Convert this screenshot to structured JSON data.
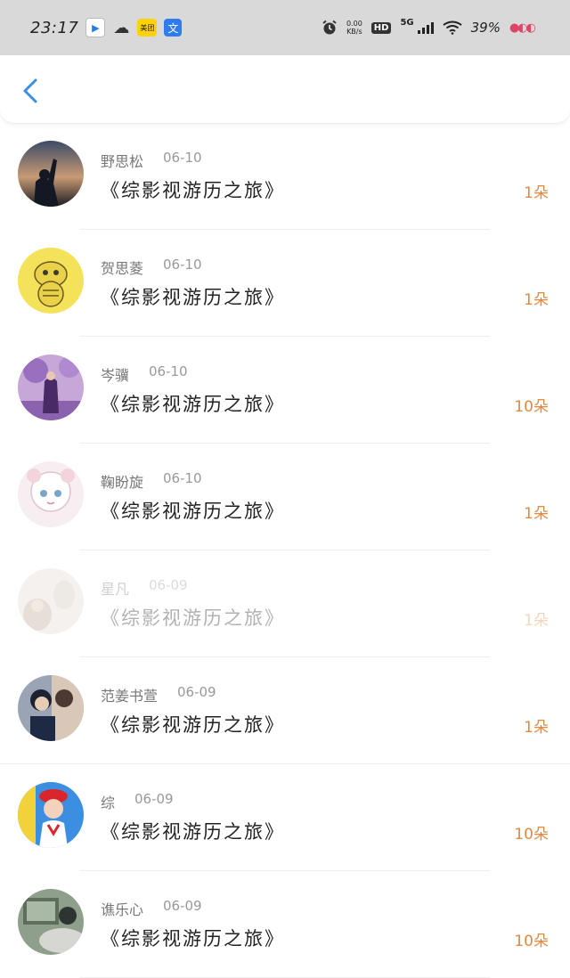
{
  "status": {
    "time": "23:17",
    "app_icons": [
      "tencent-video-icon",
      "wechat-icon",
      "meituan-icon",
      "translate-icon"
    ],
    "meituan_label": "美团",
    "translate_label": "文",
    "net_speed_value": "0.00",
    "net_speed_unit": "KB/s",
    "hd_label": "HD",
    "network": "5G",
    "battery": "39%"
  },
  "list": [
    {
      "name": "野思松",
      "date": "06-10",
      "title": "《综影视游历之旅》",
      "count": "1朵"
    },
    {
      "name": "贺思菱",
      "date": "06-10",
      "title": "《综影视游历之旅》",
      "count": "1朵"
    },
    {
      "name": "岑骥",
      "date": "06-10",
      "title": "《综影视游历之旅》",
      "count": "10朵"
    },
    {
      "name": "鞠盼旋",
      "date": "06-10",
      "title": "《综影视游历之旅》",
      "count": "1朵"
    },
    {
      "name": "星凡",
      "date": "06-09",
      "title": "《综影视游历之旅》",
      "count": "1朵"
    },
    {
      "name": "范姜书萱",
      "date": "06-09",
      "title": "《综影视游历之旅》",
      "count": "1朵"
    },
    {
      "name": "综",
      "date": "06-09",
      "title": "《综影视游历之旅》",
      "count": "10朵"
    },
    {
      "name": "谯乐心",
      "date": "06-09",
      "title": "《综影视游历之旅》",
      "count": "10朵"
    }
  ],
  "colors": {
    "accent_back": "#3a8ee6",
    "count_color": "#e08a44"
  }
}
